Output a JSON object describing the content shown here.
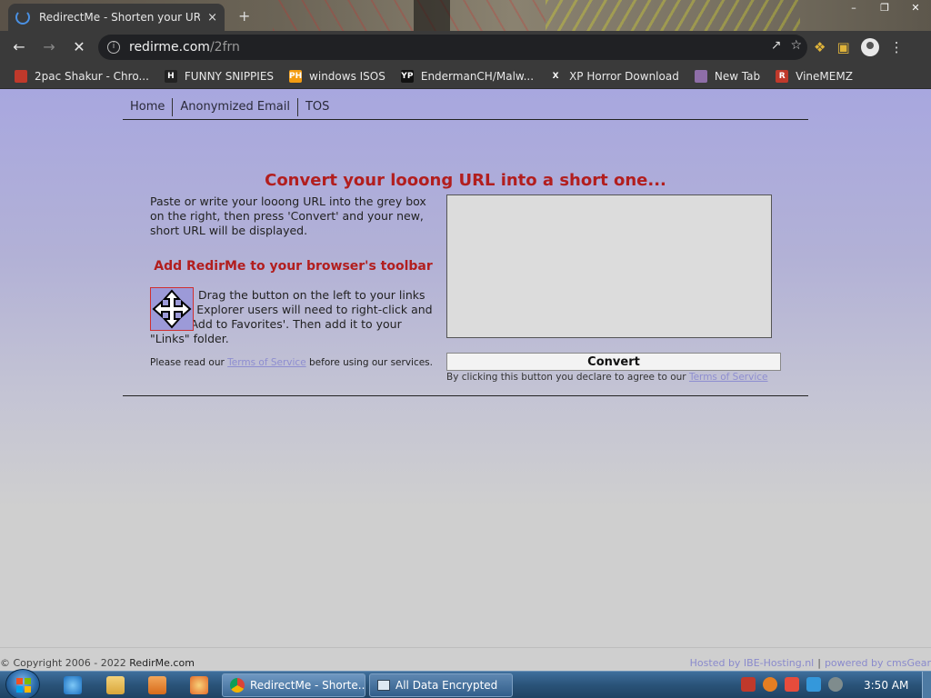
{
  "browser": {
    "tab_title": "RedirectMe - Shorten your URL f",
    "tab_close": "×",
    "new_tab": "+",
    "url_host": "redirme.com",
    "url_path": "/2frn",
    "bookmarks": [
      {
        "label": "2pac Shakur - Chro...",
        "icon": "calendar-icon",
        "color": "#c0392b",
        "glyph": ""
      },
      {
        "label": "FUNNY SNIPPIES",
        "icon": "h-logo-icon",
        "color": "#222222",
        "glyph": "H"
      },
      {
        "label": "windows ISOS",
        "icon": "ph-logo-icon",
        "color": "#f39c12",
        "glyph": "PH"
      },
      {
        "label": "EndermanCH/Malw...",
        "icon": "yp-logo-icon",
        "color": "#111111",
        "glyph": "YP"
      },
      {
        "label": "XP Horror Download",
        "icon": "x-logo-icon",
        "color": "#3a3a3a",
        "glyph": "X"
      },
      {
        "label": "New Tab",
        "icon": "globe-icon",
        "color": "#8e6ea8",
        "glyph": ""
      },
      {
        "label": "VineMEMZ",
        "icon": "r-logo-icon",
        "color": "#c0392b",
        "glyph": "R"
      }
    ]
  },
  "site": {
    "nav": [
      "Home",
      "Anonymized Email",
      "TOS"
    ],
    "headline": "Convert your looong URL into a short one...",
    "intro": "Paste or write your looong URL into the grey box on the right, then press 'Convert' and your new, short URL will be displayed.",
    "toolbar_heading": "Add RedirMe to your browser's toolbar",
    "drag_text": "Drag the button on the left to your links toolbar. Explorer users will need to right-click and select 'Add to Favorites'. Then add it to your \"Links\" folder.",
    "please_read_before": "Please read our ",
    "tos_link": "Terms of Service",
    "please_read_after": " before using our services.",
    "convert_label": "Convert",
    "declare_text": "By clicking this button you declare to agree to our ",
    "url_box_value": "",
    "footer_copyright_prefix": "© Copyright 2006 - 2022 ",
    "footer_site": "RedirMe.com",
    "footer_hosted": "Hosted by IBE-Hosting.nl",
    "footer_sep": "|",
    "footer_powered": "powered by cmsGear"
  },
  "taskbar": {
    "buttons": [
      {
        "label": "RedirectMe - Shorte...",
        "active": true
      },
      {
        "label": "All Data Encrypted",
        "active": false
      }
    ],
    "clock": "3:50 AM"
  },
  "colors": {
    "accent_red": "#b21e1e",
    "link_blue": "#8e8ed0",
    "page_bg": "#a8a7df"
  }
}
